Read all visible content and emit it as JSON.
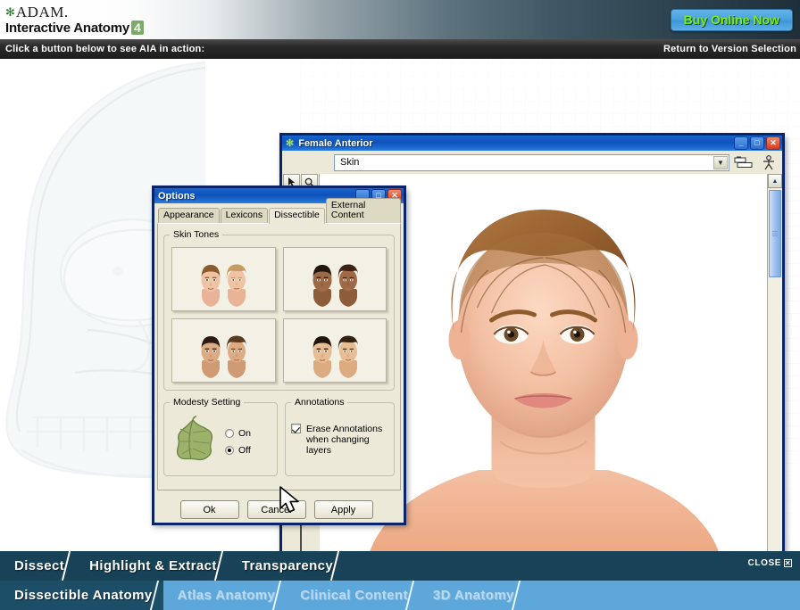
{
  "header": {
    "brand_top": "ADAM.",
    "brand_bottom": "Interactive Anatomy",
    "version_badge": "4",
    "buy_button": "Buy Online Now",
    "instruction": "Click a button below to see AIA in action:",
    "return_link": "Return to Version Selection",
    "accent_green": "#7cf000",
    "badge_green": "#7aa96a"
  },
  "female_window": {
    "title": "Female Anterior",
    "layer_select_value": "Skin",
    "buttons": {
      "minimize": "_",
      "maximize": "□",
      "close": "✕"
    },
    "toolbar_icons": [
      "layers-icon",
      "body-figure-icon"
    ],
    "mini_tools": [
      "pointer-tool",
      "magnifier-tool"
    ],
    "scroll": {
      "up": "▲",
      "down": "▼"
    }
  },
  "options_dialog": {
    "title": "Options",
    "buttons": {
      "minimize": "_",
      "maximize": "□",
      "close": "✕"
    },
    "tabs": [
      {
        "label": "Appearance",
        "active": false
      },
      {
        "label": "Lexicons",
        "active": false
      },
      {
        "label": "Dissectible",
        "active": true
      },
      {
        "label": "External Content",
        "active": false
      }
    ],
    "skin_tones": {
      "legend": "Skin Tones",
      "options": [
        {
          "name": "skin-tone-1-light",
          "selected": false
        },
        {
          "name": "skin-tone-2-dark",
          "selected": false
        },
        {
          "name": "skin-tone-3-medium",
          "selected": false
        },
        {
          "name": "skin-tone-4-asian",
          "selected": false
        }
      ]
    },
    "modesty": {
      "legend": "Modesty Setting",
      "icon": "fig-leaf-icon",
      "options": [
        {
          "label": "On",
          "selected": false
        },
        {
          "label": "Off",
          "selected": true
        }
      ]
    },
    "annotations": {
      "legend": "Annotations",
      "checkbox_label_line1": "Erase Annotations",
      "checkbox_label_line2": "when changing layers",
      "checked": true
    },
    "action_buttons": [
      {
        "label": "Ok"
      },
      {
        "label": "Cancel"
      },
      {
        "label": "Apply"
      }
    ]
  },
  "bottom_nav": {
    "row1": [
      {
        "label": "Dissect"
      },
      {
        "label": "Highlight & Extract"
      },
      {
        "label": "Transparency"
      }
    ],
    "row2": [
      {
        "label": "Dissectible Anatomy",
        "active": true
      },
      {
        "label": "Atlas Anatomy",
        "active": false
      },
      {
        "label": "Clinical Content",
        "active": false
      },
      {
        "label": "3D Anatomy",
        "active": false
      }
    ],
    "close_label": "CLOSE",
    "close_glyph": "☒"
  }
}
